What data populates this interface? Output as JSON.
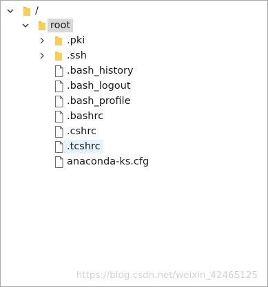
{
  "tree": {
    "root_node": {
      "label": "/",
      "expanded": true,
      "icon": "folder-icon"
    },
    "nodes": [
      {
        "label": "root",
        "type": "folder",
        "expanded": true,
        "selected": true
      },
      {
        "label": ".pki",
        "type": "folder",
        "expanded": false
      },
      {
        "label": ".ssh",
        "type": "folder",
        "expanded": false
      },
      {
        "label": ".bash_history",
        "type": "file"
      },
      {
        "label": ".bash_logout",
        "type": "file"
      },
      {
        "label": ".bash_profile",
        "type": "file"
      },
      {
        "label": ".bashrc",
        "type": "file"
      },
      {
        "label": ".cshrc",
        "type": "file"
      },
      {
        "label": ".tcshrc",
        "type": "file",
        "hovered": true
      },
      {
        "label": "anaconda-ks.cfg",
        "type": "file"
      }
    ]
  },
  "watermark": "https://blog.csdn.net/weixin_42465125",
  "colors": {
    "folder": "#f2c040",
    "selection": "#d9d9d9",
    "hover": "#e5f3ff",
    "border": "#a9a9a9"
  }
}
